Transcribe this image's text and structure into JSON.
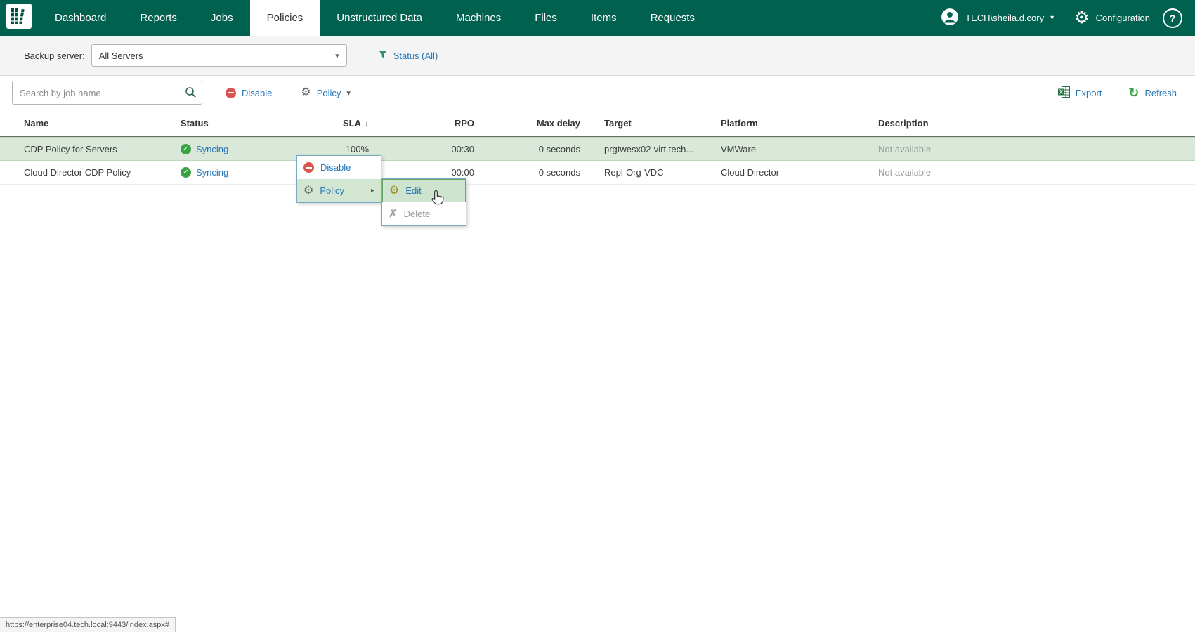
{
  "topnav": {
    "tabs": [
      {
        "label": "Dashboard"
      },
      {
        "label": "Reports"
      },
      {
        "label": "Jobs"
      },
      {
        "label": "Policies"
      },
      {
        "label": "Unstructured Data"
      },
      {
        "label": "Machines"
      },
      {
        "label": "Files"
      },
      {
        "label": "Items"
      },
      {
        "label": "Requests"
      }
    ],
    "active_tab": "Policies",
    "user": "TECH\\sheila.d.cory",
    "configuration_label": "Configuration",
    "help_label": "?"
  },
  "filterbar": {
    "backup_server_label": "Backup server:",
    "backup_server_value": "All Servers",
    "status_filter": "Status (All)"
  },
  "toolbar": {
    "search_placeholder": "Search by job name",
    "disable_label": "Disable",
    "policy_label": "Policy",
    "export_label": "Export",
    "refresh_label": "Refresh"
  },
  "table": {
    "columns": [
      "Name",
      "Status",
      "SLA",
      "RPO",
      "Max delay",
      "Target",
      "Platform",
      "Description"
    ],
    "sorted_column": "SLA",
    "sort_indicator": "↓",
    "rows": [
      {
        "name": "CDP Policy for Servers",
        "status": "Syncing",
        "sla": "100%",
        "rpo": "00:30",
        "max_delay": "0 seconds",
        "target": "prgtwesx02-virt.tech...",
        "platform": "VMWare",
        "description": "Not available"
      },
      {
        "name": "Cloud Director CDP Policy",
        "status": "Syncing",
        "sla": "",
        "rpo": "00:00",
        "max_delay": "0 seconds",
        "target": "Repl-Org-VDC",
        "platform": "Cloud Director",
        "description": "Not available"
      }
    ]
  },
  "context_menu": {
    "items": [
      {
        "label": "Disable"
      },
      {
        "label": "Policy"
      }
    ],
    "submenu": [
      {
        "label": "Edit"
      },
      {
        "label": "Delete"
      }
    ]
  },
  "statusbar": {
    "url": "https://enterprise04.tech.local:9443/index.aspx#"
  }
}
